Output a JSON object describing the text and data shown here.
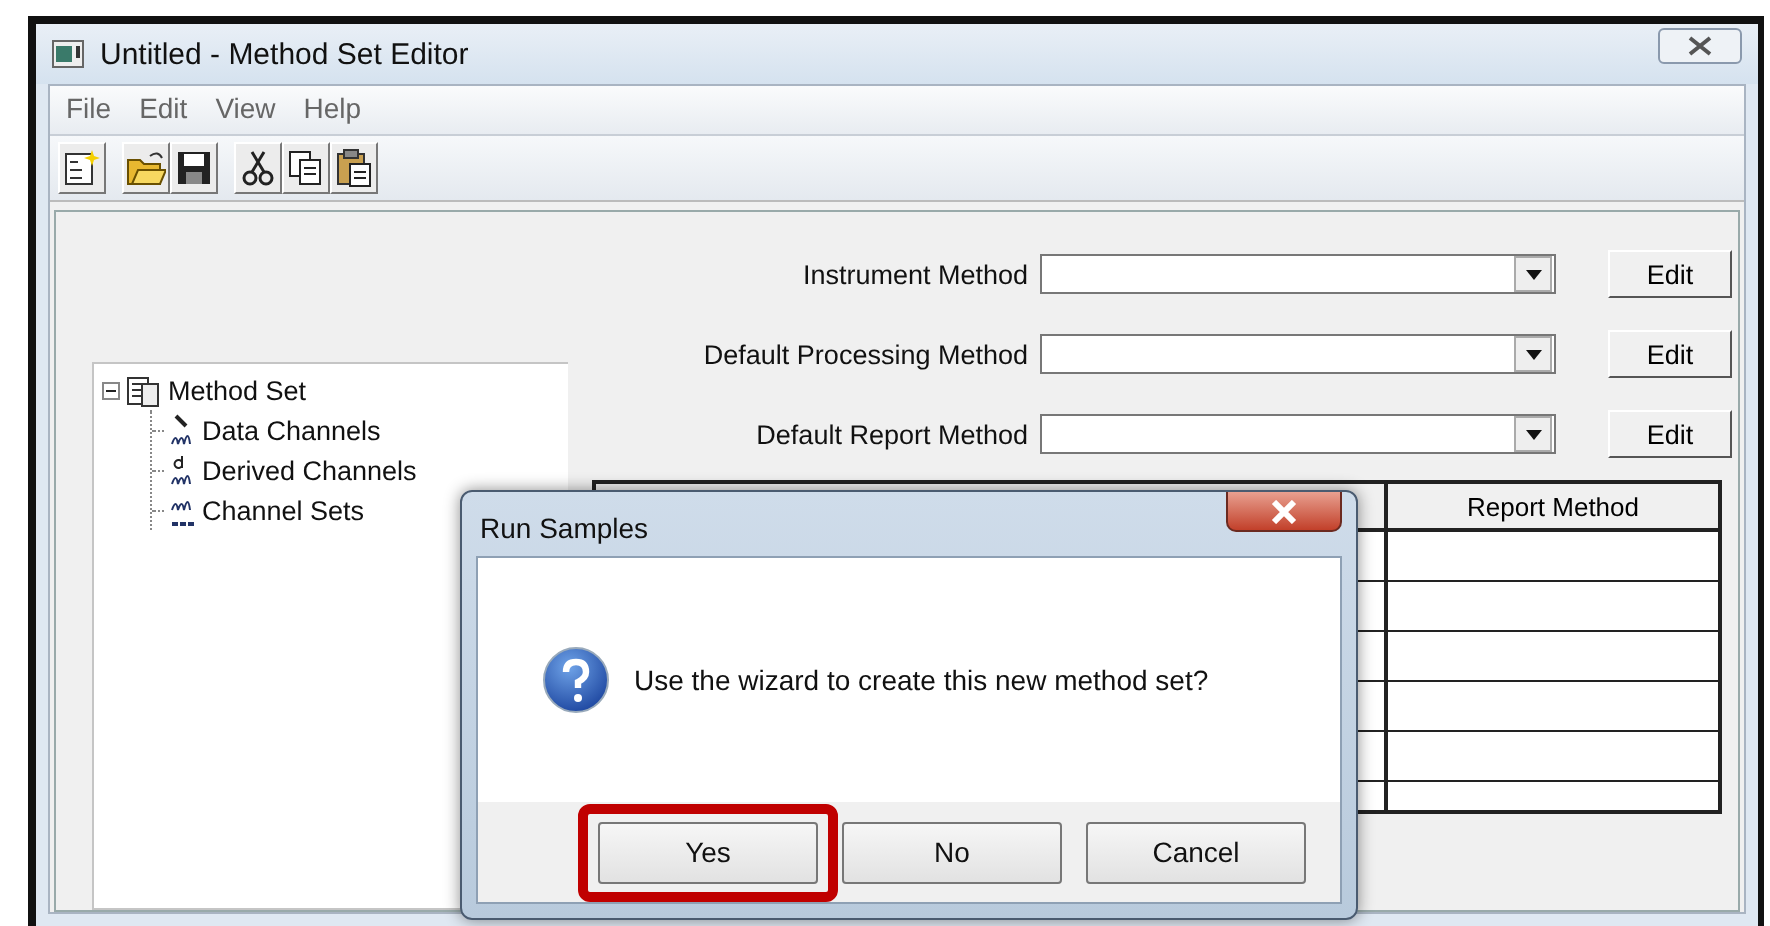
{
  "window": {
    "title": "Untitled - Method Set Editor"
  },
  "menu": [
    "File",
    "Edit",
    "View",
    "Help"
  ],
  "tree": [
    {
      "label": "Method Set",
      "expanded": true,
      "children": [
        {
          "label": "Data Channels"
        },
        {
          "label": "Derived Channels"
        },
        {
          "label": "Channel Sets"
        }
      ]
    }
  ],
  "method_fields": [
    {
      "label": "Instrument Method",
      "button": "Edit"
    },
    {
      "label": "Default Processing Method",
      "button": "Edit"
    },
    {
      "label": "Default Report Method",
      "button": "Edit"
    }
  ],
  "table": {
    "columns": [
      "Report Method"
    ]
  },
  "dialog": {
    "title": "Run Samples",
    "message": "Use the wizard to create this new method set?",
    "buttons": [
      {
        "label": "Yes",
        "highlighted": true
      },
      {
        "label": "No",
        "highlighted": false
      },
      {
        "label": "Cancel",
        "highlighted": false
      }
    ]
  }
}
